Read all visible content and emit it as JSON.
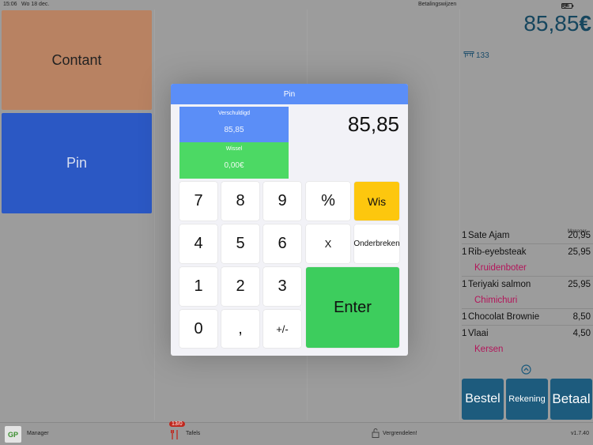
{
  "status": {
    "time": "15:06",
    "date": "Wo 18 dec.",
    "title": "Betalingswijzen",
    "battery": "2%"
  },
  "payment_methods": [
    {
      "label": "Contant",
      "color": "#b88262"
    },
    {
      "label": "Pin",
      "color": "#2b58c4"
    }
  ],
  "right": {
    "total": "85,85",
    "currency": "€",
    "table": "133",
    "manager_label": "Manager",
    "orders": [
      {
        "qty": "1",
        "name": "Sate Ajam",
        "price": "20,95",
        "modifier": ""
      },
      {
        "qty": "1",
        "name": "Rib-eyebsteak",
        "price": "25,95",
        "modifier": "Kruidenboter"
      },
      {
        "qty": "1",
        "name": "Teriyaki salmon",
        "price": "25,95",
        "modifier": "Chimichuri"
      },
      {
        "qty": "1",
        "name": "Chocolat Brownie",
        "price": "8,50",
        "modifier": ""
      },
      {
        "qty": "1",
        "name": "Vlaai",
        "price": "4,50",
        "modifier": "Kersen"
      }
    ],
    "buttons": {
      "bestel": "Bestel",
      "rekening": "Rekening",
      "betaal": "Betaal"
    }
  },
  "bottom": {
    "manager": "Manager",
    "logo": "GP",
    "badge": "13/0",
    "tables": "Tafels",
    "lock": "Vergrendelen!",
    "version": "v1.7.40"
  },
  "modal": {
    "title": "Pin",
    "owed_label": "Verschuldigd",
    "owed_value": "85,85",
    "change_label": "Wissel",
    "change_value": "0,00€",
    "display": "85,85",
    "keys": {
      "k7": "7",
      "k8": "8",
      "k9": "9",
      "pct": "%",
      "wis": "Wis",
      "k4": "4",
      "k5": "5",
      "k6": "6",
      "x": "X",
      "abort": "Onderbreken",
      "k1": "1",
      "k2": "2",
      "k3": "3",
      "enter": "Enter",
      "k0": "0",
      "comma": ",",
      "sign": "+/-"
    }
  }
}
